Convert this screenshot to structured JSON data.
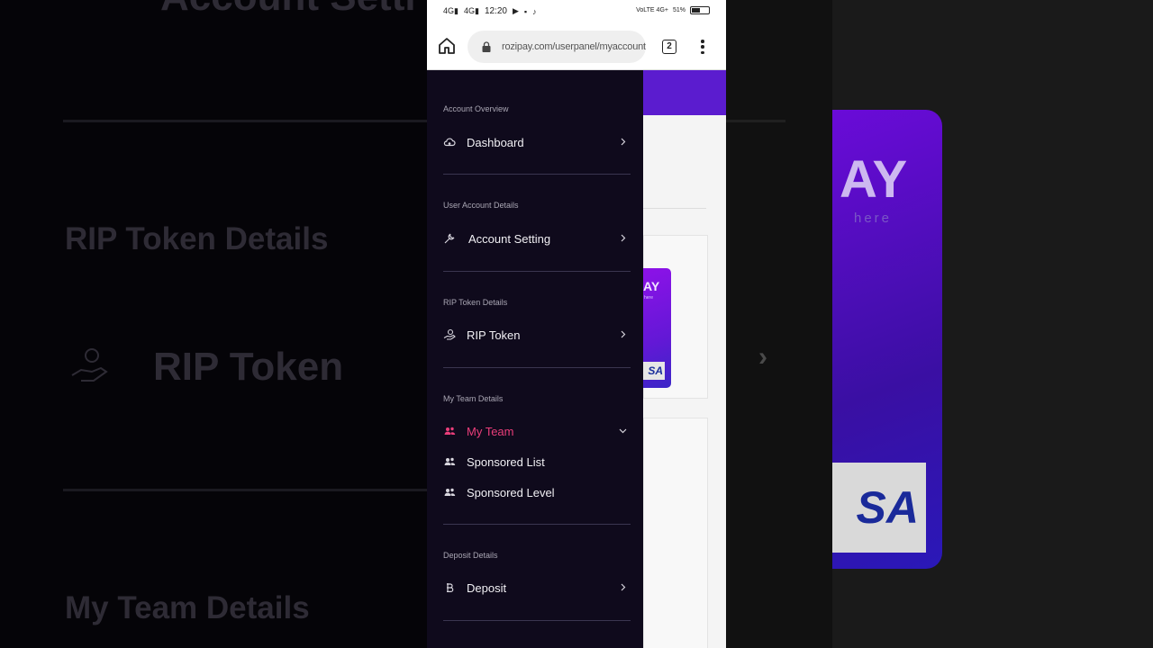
{
  "background": {
    "texts": [
      "Account Setti",
      "RIP Token Details",
      "RIP Token",
      "My Team Details",
      "AY",
      "here",
      "SA"
    ]
  },
  "status_bar": {
    "left": [
      "4G",
      "4G",
      "12:20"
    ],
    "right": [
      "VoLTE 4G+",
      "51%"
    ],
    "battery_level": 0.51
  },
  "browser": {
    "url": "rozipay.com/userpanel/myaccount.ph",
    "tab_count": "2"
  },
  "sidebar": {
    "sections": [
      {
        "title": "Account Overview",
        "items": [
          {
            "label": "Dashboard",
            "icon": "cloud-icon"
          }
        ]
      },
      {
        "title": "User Account Details",
        "items": [
          {
            "label": "Account Setting",
            "icon": "wrench-icon"
          }
        ]
      },
      {
        "title": "RIP Token Details",
        "items": [
          {
            "label": "RIP Token",
            "icon": "hand-money-icon"
          }
        ]
      },
      {
        "title": "My Team Details",
        "items": [
          {
            "label": "My Team",
            "icon": "users-icon",
            "active": true
          },
          {
            "label": "Sponsored List",
            "icon": "users-icon"
          },
          {
            "label": "Sponsored Level",
            "icon": "users-icon"
          }
        ]
      },
      {
        "title": "Deposit Details",
        "items": [
          {
            "label": "Deposit",
            "icon": "baht-icon"
          }
        ]
      }
    ]
  },
  "card": {
    "brand": "AY",
    "tagline": "here",
    "network": "SA"
  },
  "colors": {
    "accent": "#ea3e7a",
    "header_purple": "#5b1ccf",
    "drawer_bg": "#0f0a1c"
  }
}
